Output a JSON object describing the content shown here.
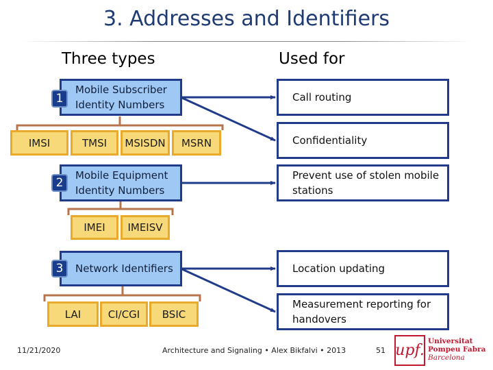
{
  "slide": {
    "title": "3. Addresses and Identifiers",
    "column_headers": {
      "types": "Three types",
      "used_for": "Used for"
    }
  },
  "types": [
    {
      "number": "1",
      "label_lines": [
        "Mobile Subscriber",
        "Identity Numbers"
      ],
      "identifiers": [
        "IMSI",
        "TMSI",
        "MSISDN",
        "MSRN"
      ]
    },
    {
      "number": "2",
      "label_lines": [
        "Mobile Equipment",
        "Identity Numbers"
      ],
      "identifiers": [
        "IMEI",
        "IMEISV"
      ]
    },
    {
      "number": "3",
      "label_lines": [
        "Network Identifiers"
      ],
      "identifiers": [
        "LAI",
        "CI/CGI",
        "BSIC"
      ]
    }
  ],
  "uses": [
    {
      "lines": [
        "Call routing"
      ]
    },
    {
      "lines": [
        "Confidentiality"
      ]
    },
    {
      "lines": [
        "Prevent use of stolen mobile",
        "stations"
      ]
    },
    {
      "lines": [
        "Location updating"
      ]
    },
    {
      "lines": [
        "Measurement reporting for",
        "handovers"
      ]
    }
  ],
  "connections": [
    {
      "from_type": "1",
      "to_use": "Call routing"
    },
    {
      "from_type": "1",
      "to_use": "Confidentiality"
    },
    {
      "from_type": "2",
      "to_use": "Prevent use of stolen mobile stations"
    },
    {
      "from_type": "3",
      "to_use": "Location updating"
    },
    {
      "from_type": "3",
      "to_use": "Measurement reporting for handovers"
    }
  ],
  "footer": {
    "date": "11/21/2020",
    "center": "Architecture and Signaling • Alex Bikfalvi • 2013",
    "page": "51",
    "logo": {
      "mark": "upf.",
      "lines": [
        "Universitat",
        "Pompeu Fabra",
        "Barcelona"
      ]
    }
  },
  "colors": {
    "title": "#1f3b73",
    "type_fill": "#9fc8f5",
    "type_border": "#1f3b8a",
    "badge": "#1a3c8c",
    "id_fill": "#f7d979",
    "id_border": "#e9a92a",
    "bracket": "#b8734a",
    "arrow": "#1f3b8a",
    "logo": "#c0162e"
  }
}
